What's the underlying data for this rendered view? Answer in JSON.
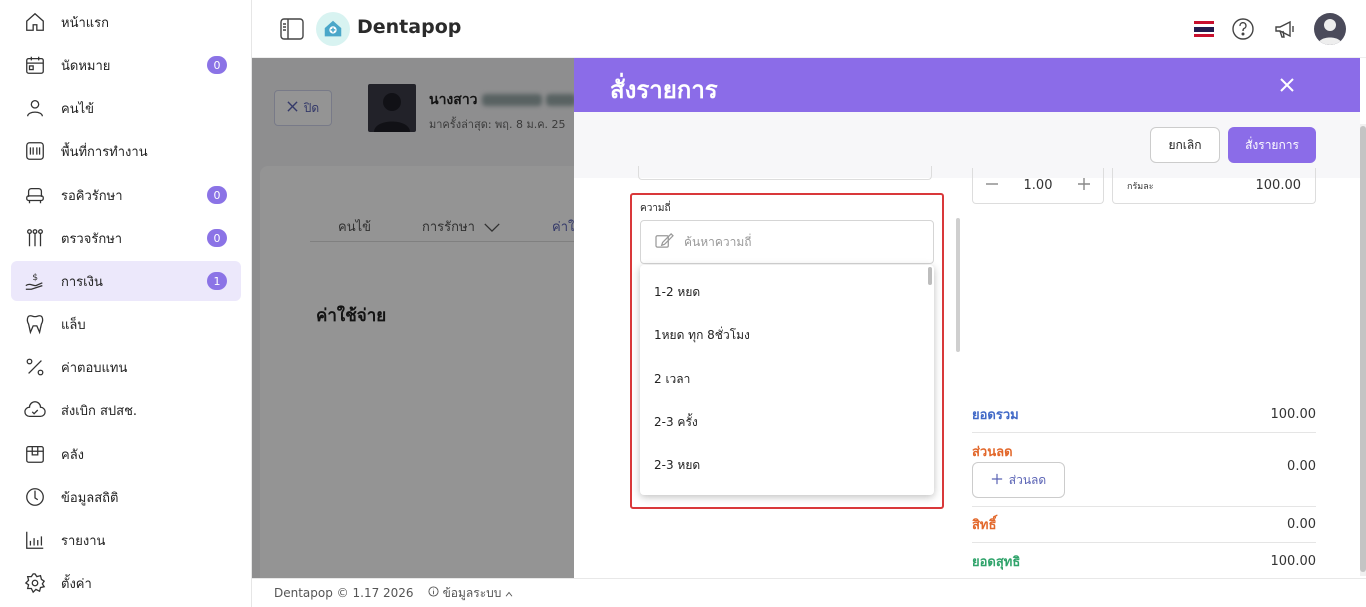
{
  "app": {
    "name": "Dentapop"
  },
  "sidebar": {
    "items": [
      {
        "label": "หน้าแรก",
        "icon": "home-icon"
      },
      {
        "label": "นัดหมาย",
        "icon": "calendar-icon",
        "badge": "0"
      },
      {
        "label": "คนไข้",
        "icon": "user-icon"
      },
      {
        "label": "พื้นที่การทำงาน",
        "icon": "workspace-icon"
      },
      {
        "label": "รอคิวรักษา",
        "icon": "dental-chair-icon",
        "badge": "0"
      },
      {
        "label": "ตรวจรักษา",
        "icon": "dental-tools-icon",
        "badge": "0"
      },
      {
        "label": "การเงิน",
        "icon": "money-hand-icon",
        "badge": "1",
        "active": true
      },
      {
        "label": "แล็บ",
        "icon": "tooth-icon"
      },
      {
        "label": "ค่าตอบแทน",
        "icon": "percent-icon"
      },
      {
        "label": "ส่งเบิก สปสช.",
        "icon": "cloud-check-icon"
      },
      {
        "label": "คลัง",
        "icon": "box-icon"
      },
      {
        "label": "ข้อมูลสถิติ",
        "icon": "statistics-icon"
      },
      {
        "label": "รายงาน",
        "icon": "bar-chart-icon"
      },
      {
        "label": "ตั้งค่า",
        "icon": "gear-icon"
      }
    ]
  },
  "background": {
    "close_label": "ปิด",
    "patient_name": "นางสาว",
    "patient_sub": "มาครั้งล่าสุด: พฤ. 8 ม.ค. 25",
    "tabs": [
      "คนไข้",
      "การรักษา",
      "ค่าใ"
    ],
    "section_title": "ค่าใช้จ่าย"
  },
  "drawer": {
    "title": "สั่งรายการ",
    "cancel_label": "ยกเลิก",
    "order_label": "สั่งรายการ",
    "quantity": "1.00",
    "unit": "กรัมละ",
    "unit_price": "100.00",
    "frequency": {
      "label": "ความถี่",
      "placeholder": "ค้นหาความถี่",
      "options": [
        "1-2 หยด",
        "1หยด ทุก 8ชั่วโมง",
        "2 เวลา",
        "2-3 ครั้ง",
        "2-3 หยด"
      ]
    },
    "summary": {
      "total_label": "ยอดรวม",
      "total_value": "100.00",
      "discount_label": "ส่วนลด",
      "discount_value": "0.00",
      "discount_button": "ส่วนลด",
      "rights_label": "สิทธิ์",
      "rights_value": "0.00",
      "net_label": "ยอดสุทธิ",
      "net_value": "100.00"
    }
  },
  "footer": {
    "copyright": "Dentapop © 1.17 2026",
    "system_info": "ข้อมูลระบบ"
  },
  "colors": {
    "accent": "#8b6ce8",
    "badge": "#8b73e6",
    "highlight_border": "#d9383a"
  }
}
